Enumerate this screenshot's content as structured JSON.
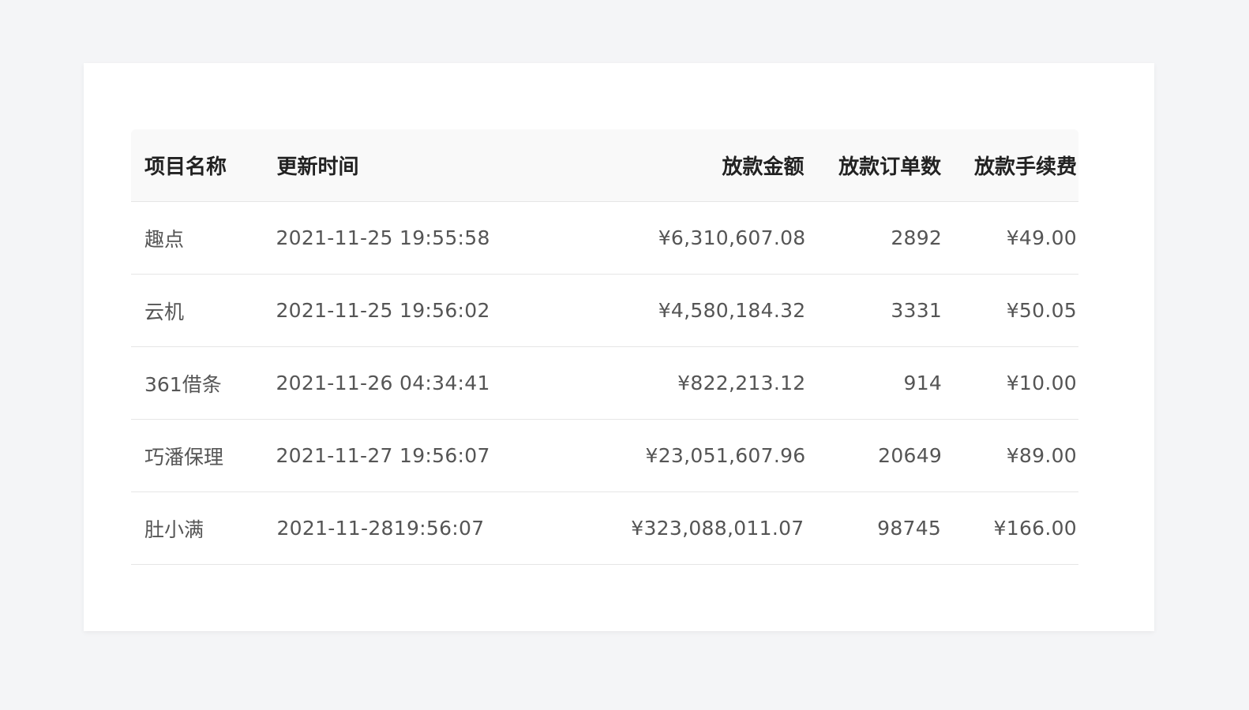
{
  "table": {
    "headers": [
      "项目名称",
      "更新时间",
      "放款金额",
      "放款订单数",
      "放款手续费"
    ],
    "rows": [
      {
        "name": "趣点",
        "time": "2021-11-25 19:55:58",
        "amount": "¥6,310,607.08",
        "orders": "2892",
        "fee": "¥49.00"
      },
      {
        "name": "云机",
        "time": "2021-11-25 19:56:02",
        "amount": "¥4,580,184.32",
        "orders": "3331",
        "fee": "¥50.05"
      },
      {
        "name": "361借条",
        "time": "2021-11-26 04:34:41",
        "amount": "¥822,213.12",
        "orders": "914",
        "fee": "¥10.00"
      },
      {
        "name": "巧潘保理",
        "time": "2021-11-27 19:56:07",
        "amount": "¥23,051,607.96",
        "orders": "20649",
        "fee": "¥89.00"
      },
      {
        "name": "肚小满",
        "time": "2021-11-2819:56:07",
        "amount": "¥323,088,011.07",
        "orders": "98745",
        "fee": "¥166.00"
      }
    ]
  }
}
